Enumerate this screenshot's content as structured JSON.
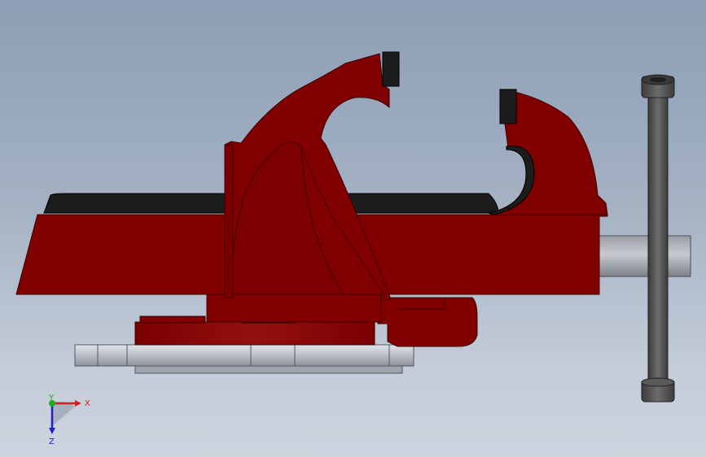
{
  "view": {
    "background_top": "#8d9db3",
    "background_bottom": "#ccd4de"
  },
  "model": {
    "colors": {
      "body": "#800000",
      "body_highlight": "#8f0a0a",
      "jaw_insert": "#1c1c1c",
      "steel": "#b4b8c0",
      "steel_dark": "#8a8e96",
      "handle": "#555555"
    }
  },
  "triad": {
    "x_label": "X",
    "y_label": "Y",
    "z_label": "Z",
    "x_color": "#d62020",
    "y_color": "#1faa1f",
    "z_color": "#2020c8"
  }
}
